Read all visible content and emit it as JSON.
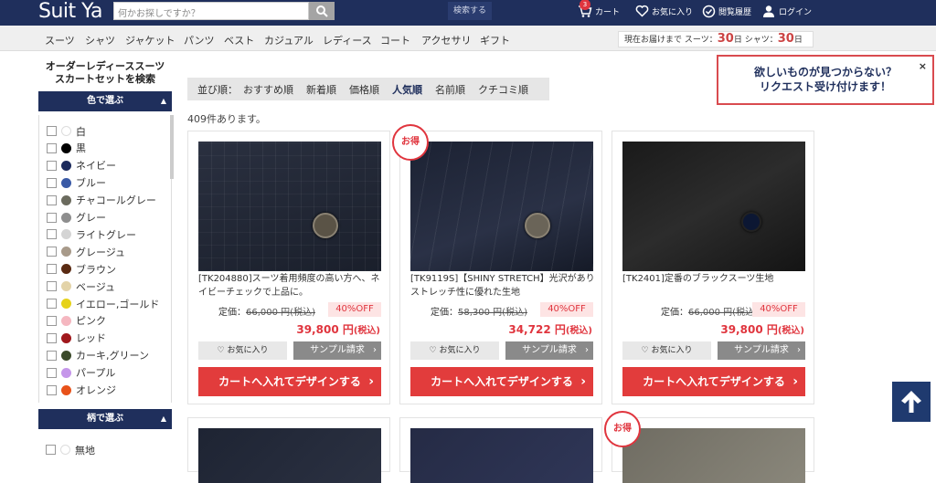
{
  "header": {
    "logo": "Suit Ya",
    "search_placeholder": "何かお探しですか？",
    "search_submit": "検索する",
    "cart_count": "3",
    "cart_label": "カート",
    "favorites_label": "お気に入り",
    "history_label": "閲覧履歴",
    "login_label": "ログイン"
  },
  "categories": [
    "スーツ",
    "シャツ",
    "ジャケット",
    "パンツ",
    "ベスト",
    "カジュアル",
    "レディース",
    "コート",
    "アクセサリ",
    "ギフト"
  ],
  "delivery": {
    "prefix": "現在お届けまで",
    "suit_label": "スーツ：",
    "suit_days": "30",
    "day_unit": "日",
    "shirt_label": "シャツ：",
    "shirt_days": "30"
  },
  "sidebar": {
    "title_line1": "オーダーレディーススーツ",
    "title_line2": "スカートセットを検索",
    "color_heading": "色で選ぶ",
    "pattern_heading": "柄で選ぶ",
    "colors": [
      {
        "label": "白",
        "color": "#ffffff"
      },
      {
        "label": "黒",
        "color": "#000000"
      },
      {
        "label": "ネイビー",
        "color": "#1c2a5c"
      },
      {
        "label": "ブルー",
        "color": "#3a5aa6"
      },
      {
        "label": "チャコールグレー",
        "color": "#6b6b5e"
      },
      {
        "label": "グレー",
        "color": "#8e8e8e"
      },
      {
        "label": "ライトグレー",
        "color": "#d4d4d4"
      },
      {
        "label": "グレージュ",
        "color": "#a89a8a"
      },
      {
        "label": "ブラウン",
        "color": "#5a2a12"
      },
      {
        "label": "ベージュ",
        "color": "#e3d3a8"
      },
      {
        "label": "イエロー,ゴールド",
        "color": "#e6d21a"
      },
      {
        "label": "ピンク",
        "color": "#f5b7c0"
      },
      {
        "label": "レッド",
        "color": "#a0181c"
      },
      {
        "label": "カーキ,グリーン",
        "color": "#3b4a2a"
      },
      {
        "label": "パープル",
        "color": "#c596ea"
      },
      {
        "label": "オレンジ",
        "color": "#e8521a"
      }
    ],
    "patterns": [
      {
        "label": "無地",
        "color": "#ffffff"
      }
    ]
  },
  "sort": {
    "label": "並び順：",
    "options": [
      "おすすめ順",
      "新着順",
      "価格順",
      "人気順",
      "名前順",
      "クチコミ順"
    ],
    "active": "人気順"
  },
  "result_count": "409件あります。",
  "request_box": {
    "line1": "欲しいものが見つからない？",
    "line2": "リクエスト受け付けます！",
    "close": "×"
  },
  "products": [
    {
      "title": "[TK204880]スーツ着用頻度の高い方へ、ネイビーチェックで上品に。",
      "list_label": "定価：",
      "list_price": "66,000 円(税込)",
      "discount": "40%OFF",
      "price": "39,800 円",
      "tax": "(税込)",
      "deal": false,
      "fav": "お気に入り",
      "sample": "サンプル請求",
      "cart": "カートへ入れてデザインする"
    },
    {
      "title": "[TK9119S]【SHINY STRETCH】光沢がありストレッチ性に優れた生地",
      "list_label": "定価：",
      "list_price": "58,300 円(税込)",
      "discount": "40%OFF",
      "price": "34,722 円",
      "tax": "(税込)",
      "deal": true,
      "fav": "お気に入り",
      "sample": "サンプル請求",
      "cart": "カートへ入れてデザインする"
    },
    {
      "title": "[TK2401]定番のブラックスーツ生地",
      "list_label": "定価：",
      "list_price": "66,000 円(税込)",
      "discount": "40%OFF",
      "price": "39,800 円",
      "tax": "(税込)",
      "deal": false,
      "fav": "お気に入り",
      "sample": "サンプル請求",
      "cart": "カートへ入れてデザインする"
    }
  ],
  "deal_badge": "お得",
  "colors": {
    "navy": "#1f2f5c",
    "red": "#e23c3c",
    "gray_button": "#8a8a8a"
  }
}
